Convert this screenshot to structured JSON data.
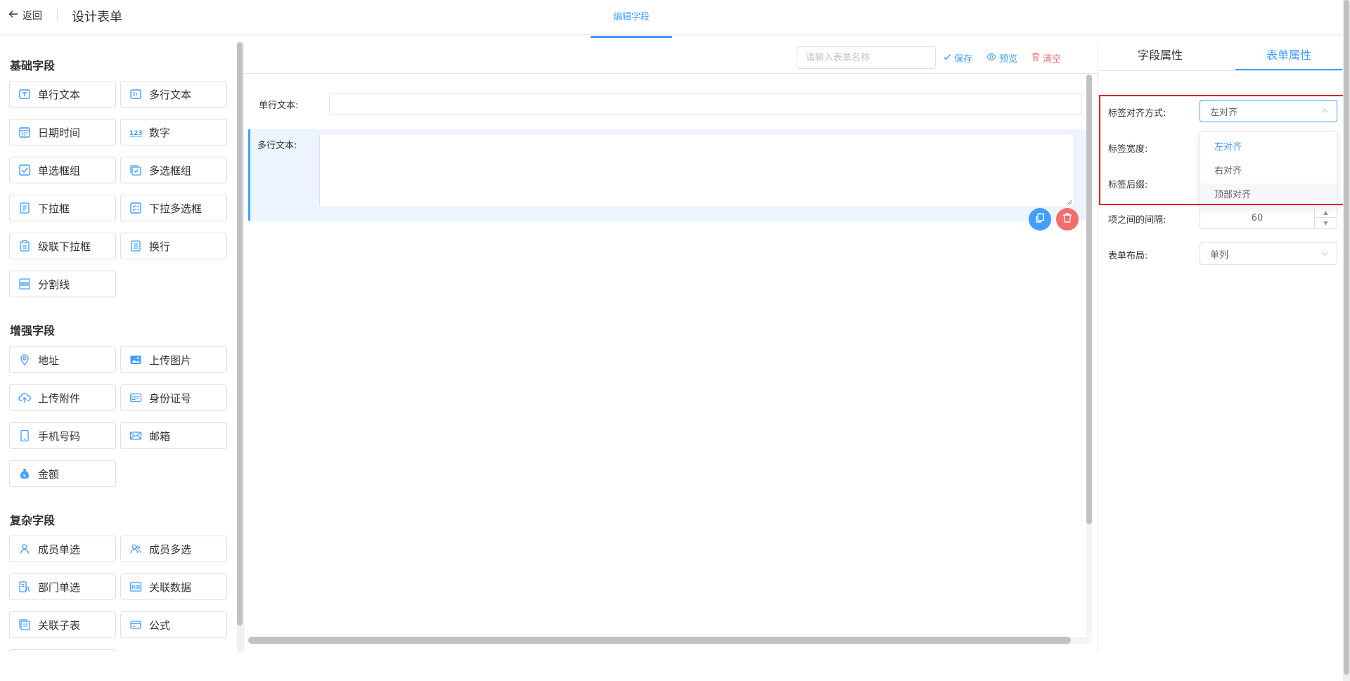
{
  "header": {
    "back_label": "返回",
    "title": "设计表单",
    "center_tab": "编辑字段"
  },
  "sidebar": {
    "sections": [
      {
        "title": "基础字段"
      },
      {
        "title": "增强字段"
      },
      {
        "title": "复杂字段"
      }
    ],
    "basic": [
      {
        "label": "单行文本",
        "icon": "text-input-icon"
      },
      {
        "label": "多行文本",
        "icon": "textarea-icon"
      },
      {
        "label": "日期时间",
        "icon": "calendar-icon"
      },
      {
        "label": "数字",
        "icon": "number-icon"
      },
      {
        "label": "单选框组",
        "icon": "checkbox-square-icon"
      },
      {
        "label": "多选框组",
        "icon": "multi-checkbox-icon"
      },
      {
        "label": "下拉框",
        "icon": "dropdown-doc-icon"
      },
      {
        "label": "下拉多选框",
        "icon": "checklist-icon"
      },
      {
        "label": "级联下拉框",
        "icon": "clipboard-icon"
      },
      {
        "label": "换行",
        "icon": "document-lines-icon"
      },
      {
        "label": "分割线",
        "icon": "split-line-icon"
      }
    ],
    "enhanced": [
      {
        "label": "地址",
        "icon": "location-pin-icon"
      },
      {
        "label": "上传图片",
        "icon": "image-icon"
      },
      {
        "label": "上传附件",
        "icon": "cloud-upload-icon"
      },
      {
        "label": "身份证号",
        "icon": "id-card-icon"
      },
      {
        "label": "手机号码",
        "icon": "mobile-phone-icon"
      },
      {
        "label": "邮箱",
        "icon": "mail-icon"
      },
      {
        "label": "金额",
        "icon": "money-bag-icon"
      }
    ],
    "complex": [
      {
        "label": "成员单选",
        "icon": "user-icon"
      },
      {
        "label": "成员多选",
        "icon": "users-icon"
      },
      {
        "label": "部门单选",
        "icon": "department-icon"
      },
      {
        "label": "关联数据",
        "icon": "barcode-icon"
      },
      {
        "label": "关联子表",
        "icon": "sub-table-icon"
      },
      {
        "label": "公式",
        "icon": "formula-card-icon"
      }
    ]
  },
  "toolbar": {
    "form_name_placeholder": "请输入表单名称",
    "save_label": "保存",
    "preview_label": "预览",
    "clear_label": "清空"
  },
  "canvas": {
    "fields": [
      {
        "label": "单行文本:"
      },
      {
        "label": "多行文本:"
      }
    ]
  },
  "properties": {
    "tabs": [
      {
        "label": "字段属性"
      },
      {
        "label": "表单属性"
      }
    ],
    "label_align": {
      "label": "标签对齐方式:",
      "value": "左对齐"
    },
    "label_width": {
      "label": "标签宽度:"
    },
    "label_suffix": {
      "label": "标签后缀:"
    },
    "item_gap": {
      "label": "项之间的间隔:",
      "value": "60"
    },
    "layout": {
      "label": "表单布局:",
      "value": "单列"
    },
    "align_options": [
      "左对齐",
      "右对齐",
      "顶部对齐"
    ]
  },
  "colors": {
    "accent": "#409eff",
    "danger": "#f56c6c",
    "highlight_box": "#e02020"
  }
}
